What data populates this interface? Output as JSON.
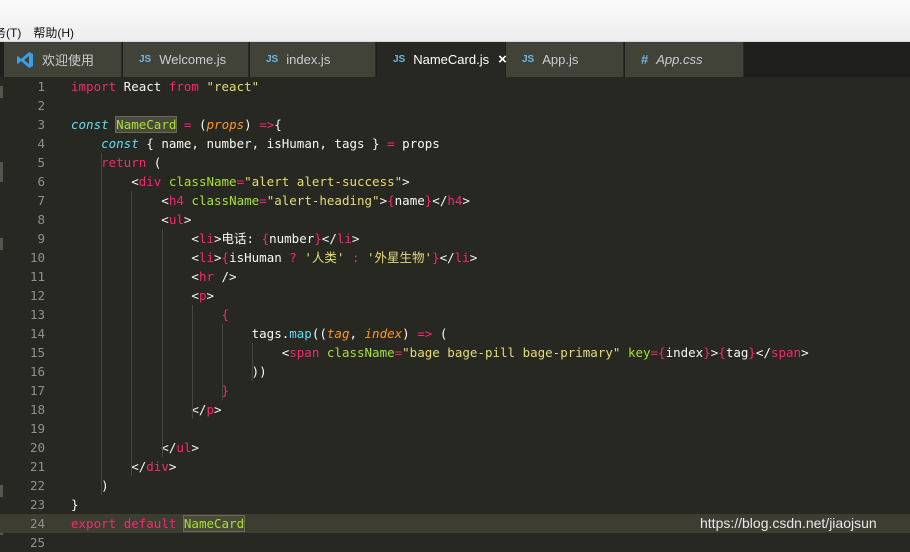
{
  "menubar": {
    "items": [
      "务(T)",
      "帮助(H)"
    ]
  },
  "tabs": [
    {
      "label": "欢迎使用",
      "icon": "vscode-icon",
      "active": false
    },
    {
      "label": "Welcome.js",
      "icon": "js-file-icon",
      "badge": "JS",
      "active": false
    },
    {
      "label": "index.js",
      "icon": "js-file-icon",
      "badge": "JS",
      "active": false
    },
    {
      "label": "NameCard.js",
      "icon": "js-file-icon",
      "badge": "JS",
      "active": true,
      "close": "×"
    },
    {
      "label": "App.js",
      "icon": "js-file-icon",
      "badge": "JS",
      "active": false
    },
    {
      "label": "App.css",
      "icon": "css-file-icon",
      "badge": "#",
      "active": false
    }
  ],
  "lines": [
    {
      "n": "1",
      "tokens": [
        [
          "k",
          "import"
        ],
        [
          "w",
          " React "
        ],
        [
          "k",
          "from"
        ],
        [
          "w",
          " "
        ],
        [
          "s",
          "\"react\""
        ]
      ]
    },
    {
      "n": "2",
      "tokens": []
    },
    {
      "n": "3",
      "tokens": [
        [
          "ki",
          "const"
        ],
        [
          "w",
          " "
        ],
        [
          "n",
          "NameCard"
        ],
        [
          "w",
          " "
        ],
        [
          "k",
          "="
        ],
        [
          "w",
          " ("
        ],
        [
          "p",
          "props"
        ],
        [
          "w",
          ") "
        ],
        [
          "k",
          "=>"
        ],
        [
          "w",
          "{"
        ]
      ]
    },
    {
      "n": "4",
      "tokens": [
        [
          "w",
          "    "
        ],
        [
          "ki",
          "const"
        ],
        [
          "w",
          " { name, number, isHuman, tags } "
        ],
        [
          "k",
          "="
        ],
        [
          "w",
          " props"
        ]
      ]
    },
    {
      "n": "5",
      "tokens": [
        [
          "w",
          "    "
        ],
        [
          "k",
          "return"
        ],
        [
          "w",
          " ("
        ]
      ]
    },
    {
      "n": "6",
      "tokens": [
        [
          "w",
          "        <"
        ],
        [
          "t",
          "div"
        ],
        [
          "w",
          " "
        ],
        [
          "a",
          "className"
        ],
        [
          "k",
          "="
        ],
        [
          "s",
          "\"alert alert-success\""
        ],
        [
          "w",
          ">"
        ]
      ]
    },
    {
      "n": "7",
      "tokens": [
        [
          "w",
          "            <"
        ],
        [
          "t",
          "h4"
        ],
        [
          "w",
          " "
        ],
        [
          "a",
          "className"
        ],
        [
          "k",
          "="
        ],
        [
          "s",
          "\"alert-heading\""
        ],
        [
          "w",
          ">"
        ],
        [
          "b",
          "{"
        ],
        [
          "w",
          "name"
        ],
        [
          "b",
          "}"
        ],
        [
          "w",
          "</"
        ],
        [
          "t",
          "h4"
        ],
        [
          "w",
          ">"
        ]
      ]
    },
    {
      "n": "8",
      "tokens": [
        [
          "w",
          "            <"
        ],
        [
          "t",
          "ul"
        ],
        [
          "w",
          ">"
        ]
      ]
    },
    {
      "n": "9",
      "tokens": [
        [
          "w",
          "                <"
        ],
        [
          "t",
          "li"
        ],
        [
          "w",
          ">电话: "
        ],
        [
          "b",
          "{"
        ],
        [
          "w",
          "number"
        ],
        [
          "b",
          "}"
        ],
        [
          "w",
          "</"
        ],
        [
          "t",
          "li"
        ],
        [
          "w",
          ">"
        ]
      ]
    },
    {
      "n": "10",
      "tokens": [
        [
          "w",
          "                <"
        ],
        [
          "t",
          "li"
        ],
        [
          "w",
          ">"
        ],
        [
          "b",
          "{"
        ],
        [
          "w",
          "isHuman "
        ],
        [
          "k",
          "?"
        ],
        [
          "w",
          " "
        ],
        [
          "s",
          "'人类'"
        ],
        [
          "w",
          " "
        ],
        [
          "k",
          ":"
        ],
        [
          "w",
          " "
        ],
        [
          "s",
          "'外星生物'"
        ],
        [
          "b",
          "}"
        ],
        [
          "w",
          "</"
        ],
        [
          "t",
          "li"
        ],
        [
          "w",
          ">"
        ]
      ]
    },
    {
      "n": "11",
      "tokens": [
        [
          "w",
          "                <"
        ],
        [
          "t",
          "hr"
        ],
        [
          "w",
          " />"
        ]
      ]
    },
    {
      "n": "12",
      "tokens": [
        [
          "w",
          "                <"
        ],
        [
          "t",
          "p"
        ],
        [
          "w",
          ">"
        ]
      ]
    },
    {
      "n": "13",
      "tokens": [
        [
          "w",
          "                    "
        ],
        [
          "b",
          "{"
        ]
      ]
    },
    {
      "n": "14",
      "tokens": [
        [
          "w",
          "                        tags."
        ],
        [
          "f",
          "map"
        ],
        [
          "w",
          "(("
        ],
        [
          "p",
          "tag"
        ],
        [
          "w",
          ", "
        ],
        [
          "p",
          "index"
        ],
        [
          "w",
          ") "
        ],
        [
          "k",
          "=>"
        ],
        [
          "w",
          " ("
        ]
      ]
    },
    {
      "n": "15",
      "tokens": [
        [
          "w",
          "                            <"
        ],
        [
          "t",
          "span"
        ],
        [
          "w",
          " "
        ],
        [
          "a",
          "className"
        ],
        [
          "k",
          "="
        ],
        [
          "s",
          "\"bage bage-pill bage-primary\""
        ],
        [
          "w",
          " "
        ],
        [
          "a",
          "key"
        ],
        [
          "k",
          "="
        ],
        [
          "b",
          "{"
        ],
        [
          "w",
          "index"
        ],
        [
          "b",
          "}"
        ],
        [
          "w",
          ">"
        ],
        [
          "b",
          "{"
        ],
        [
          "w",
          "tag"
        ],
        [
          "b",
          "}"
        ],
        [
          "w",
          "</"
        ],
        [
          "t",
          "span"
        ],
        [
          "w",
          ">"
        ]
      ]
    },
    {
      "n": "16",
      "tokens": [
        [
          "w",
          "                        ))"
        ]
      ]
    },
    {
      "n": "17",
      "tokens": [
        [
          "w",
          "                    "
        ],
        [
          "b",
          "}"
        ]
      ]
    },
    {
      "n": "18",
      "tokens": [
        [
          "w",
          "                </"
        ],
        [
          "t",
          "p"
        ],
        [
          "w",
          ">"
        ]
      ]
    },
    {
      "n": "19",
      "tokens": []
    },
    {
      "n": "20",
      "tokens": [
        [
          "w",
          "            </"
        ],
        [
          "t",
          "ul"
        ],
        [
          "w",
          ">"
        ]
      ]
    },
    {
      "n": "21",
      "tokens": [
        [
          "w",
          "        </"
        ],
        [
          "t",
          "div"
        ],
        [
          "w",
          ">"
        ]
      ]
    },
    {
      "n": "22",
      "tokens": [
        [
          "w",
          "    )"
        ]
      ]
    },
    {
      "n": "23",
      "tokens": [
        [
          "w",
          "}"
        ]
      ]
    },
    {
      "n": "24",
      "tokens": [
        [
          "k",
          "export"
        ],
        [
          "w",
          " "
        ],
        [
          "k",
          "default"
        ],
        [
          "w",
          " "
        ],
        [
          "n",
          "NameCard"
        ]
      ],
      "highlight": true
    },
    {
      "n": "25",
      "tokens": []
    }
  ],
  "watermark": "https://blog.csdn.net/jiaojsun",
  "colors": {
    "background": "#272822",
    "keyword": "#f92672",
    "string": "#e6db74",
    "attribute": "#a6e22e",
    "parameter": "#fd971f",
    "function": "#66d9ef"
  }
}
